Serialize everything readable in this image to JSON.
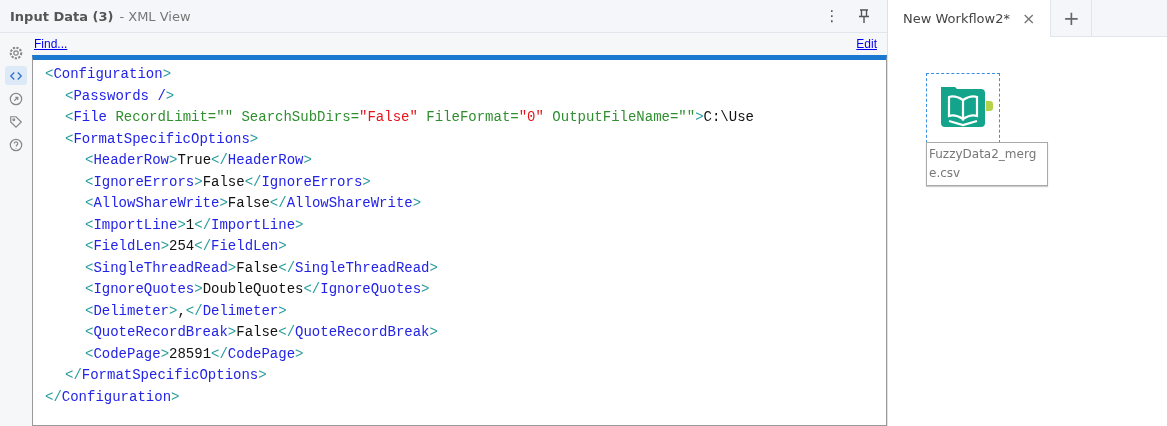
{
  "panel": {
    "title": "Input Data (3)",
    "subtitle": "- XML View",
    "menu_glyph": "⋮",
    "find_link": "Find...",
    "edit_link": "Edit"
  },
  "side_tools": [
    {
      "kind": "gear",
      "selected": false
    },
    {
      "kind": "code",
      "selected": true
    },
    {
      "kind": "arrow",
      "selected": false
    },
    {
      "kind": "tag",
      "selected": false
    },
    {
      "kind": "help",
      "selected": false
    }
  ],
  "xml_lines": [
    {
      "tokens": [
        {
          "kind": "punct",
          "text": "<"
        },
        {
          "kind": "name",
          "text": "Configuration"
        },
        {
          "kind": "punct",
          "text": ">"
        }
      ],
      "children": [
        {
          "tokens": [
            {
              "kind": "punct",
              "text": "<"
            },
            {
              "kind": "name",
              "text": "Passwords /"
            },
            {
              "kind": "punct",
              "text": ">"
            }
          ]
        },
        {
          "tokens": [
            {
              "kind": "punct",
              "text": "<"
            },
            {
              "kind": "name",
              "text": "File "
            },
            {
              "kind": "attr",
              "text": "RecordLimit=\"\" SearchSubDirs="
            },
            {
              "kind": "value",
              "text": "\"False\""
            },
            {
              "kind": "attr",
              "text": " FileFormat="
            },
            {
              "kind": "value",
              "text": "\"0\""
            },
            {
              "kind": "attr",
              "text": " OutputFileName=\"\""
            },
            {
              "kind": "punct",
              "text": ">"
            },
            {
              "kind": "text",
              "text": "C:\\Use"
            }
          ]
        },
        {
          "tokens": [
            {
              "kind": "punct",
              "text": "<"
            },
            {
              "kind": "name",
              "text": "FormatSpecificOptions"
            },
            {
              "kind": "punct",
              "text": ">"
            }
          ],
          "children": [
            {
              "tokens": [
                {
                  "kind": "punct",
                  "text": "<"
                },
                {
                  "kind": "name",
                  "text": "HeaderRow"
                },
                {
                  "kind": "punct",
                  "text": ">"
                },
                {
                  "kind": "text",
                  "text": "True"
                },
                {
                  "kind": "punct",
                  "text": "</"
                },
                {
                  "kind": "name",
                  "text": "HeaderRow"
                },
                {
                  "kind": "punct",
                  "text": ">"
                }
              ]
            },
            {
              "tokens": [
                {
                  "kind": "punct",
                  "text": "<"
                },
                {
                  "kind": "name",
                  "text": "IgnoreErrors"
                },
                {
                  "kind": "punct",
                  "text": ">"
                },
                {
                  "kind": "text",
                  "text": "False"
                },
                {
                  "kind": "punct",
                  "text": "</"
                },
                {
                  "kind": "name",
                  "text": "IgnoreErrors"
                },
                {
                  "kind": "punct",
                  "text": ">"
                }
              ]
            },
            {
              "tokens": [
                {
                  "kind": "punct",
                  "text": "<"
                },
                {
                  "kind": "name",
                  "text": "AllowShareWrite"
                },
                {
                  "kind": "punct",
                  "text": ">"
                },
                {
                  "kind": "text",
                  "text": "False"
                },
                {
                  "kind": "punct",
                  "text": "</"
                },
                {
                  "kind": "name",
                  "text": "AllowShareWrite"
                },
                {
                  "kind": "punct",
                  "text": ">"
                }
              ]
            },
            {
              "tokens": [
                {
                  "kind": "punct",
                  "text": "<"
                },
                {
                  "kind": "name",
                  "text": "ImportLine"
                },
                {
                  "kind": "punct",
                  "text": ">"
                },
                {
                  "kind": "text",
                  "text": "1"
                },
                {
                  "kind": "punct",
                  "text": "</"
                },
                {
                  "kind": "name",
                  "text": "ImportLine"
                },
                {
                  "kind": "punct",
                  "text": ">"
                }
              ]
            },
            {
              "tokens": [
                {
                  "kind": "punct",
                  "text": "<"
                },
                {
                  "kind": "name",
                  "text": "FieldLen"
                },
                {
                  "kind": "punct",
                  "text": ">"
                },
                {
                  "kind": "text",
                  "text": "254"
                },
                {
                  "kind": "punct",
                  "text": "</"
                },
                {
                  "kind": "name",
                  "text": "FieldLen"
                },
                {
                  "kind": "punct",
                  "text": ">"
                }
              ]
            },
            {
              "tokens": [
                {
                  "kind": "punct",
                  "text": "<"
                },
                {
                  "kind": "name",
                  "text": "SingleThreadRead"
                },
                {
                  "kind": "punct",
                  "text": ">"
                },
                {
                  "kind": "text",
                  "text": "False"
                },
                {
                  "kind": "punct",
                  "text": "</"
                },
                {
                  "kind": "name",
                  "text": "SingleThreadRead"
                },
                {
                  "kind": "punct",
                  "text": ">"
                }
              ]
            },
            {
              "tokens": [
                {
                  "kind": "punct",
                  "text": "<"
                },
                {
                  "kind": "name",
                  "text": "IgnoreQuotes"
                },
                {
                  "kind": "punct",
                  "text": ">"
                },
                {
                  "kind": "text",
                  "text": "DoubleQuotes"
                },
                {
                  "kind": "punct",
                  "text": "</"
                },
                {
                  "kind": "name",
                  "text": "IgnoreQuotes"
                },
                {
                  "kind": "punct",
                  "text": ">"
                }
              ]
            },
            {
              "tokens": [
                {
                  "kind": "punct",
                  "text": "<"
                },
                {
                  "kind": "name",
                  "text": "Delimeter"
                },
                {
                  "kind": "punct",
                  "text": ">"
                },
                {
                  "kind": "text",
                  "text": ","
                },
                {
                  "kind": "punct",
                  "text": "</"
                },
                {
                  "kind": "name",
                  "text": "Delimeter"
                },
                {
                  "kind": "punct",
                  "text": ">"
                }
              ]
            },
            {
              "tokens": [
                {
                  "kind": "punct",
                  "text": "<"
                },
                {
                  "kind": "name",
                  "text": "QuoteRecordBreak"
                },
                {
                  "kind": "punct",
                  "text": ">"
                },
                {
                  "kind": "text",
                  "text": "False"
                },
                {
                  "kind": "punct",
                  "text": "</"
                },
                {
                  "kind": "name",
                  "text": "QuoteRecordBreak"
                },
                {
                  "kind": "punct",
                  "text": ">"
                }
              ]
            },
            {
              "tokens": [
                {
                  "kind": "punct",
                  "text": "<"
                },
                {
                  "kind": "name",
                  "text": "CodePage"
                },
                {
                  "kind": "punct",
                  "text": ">"
                },
                {
                  "kind": "text",
                  "text": "28591"
                },
                {
                  "kind": "punct",
                  "text": "</"
                },
                {
                  "kind": "name",
                  "text": "CodePage"
                },
                {
                  "kind": "punct",
                  "text": ">"
                }
              ]
            }
          ]
        },
        {
          "tokens": [
            {
              "kind": "punct",
              "text": "</"
            },
            {
              "kind": "name",
              "text": "FormatSpecificOptions"
            },
            {
              "kind": "punct",
              "text": ">"
            }
          ]
        }
      ]
    },
    {
      "tokens": [
        {
          "kind": "punct",
          "text": "</"
        },
        {
          "kind": "name",
          "text": "Configuration"
        },
        {
          "kind": "punct",
          "text": ">"
        }
      ]
    }
  ],
  "tabs": [
    {
      "label": "New Workflow2*",
      "close": "×",
      "selected": true
    }
  ],
  "new_tab": "+",
  "canvas": {
    "tool_label": "FuzzyData2_merg e.csv",
    "selected": true
  }
}
